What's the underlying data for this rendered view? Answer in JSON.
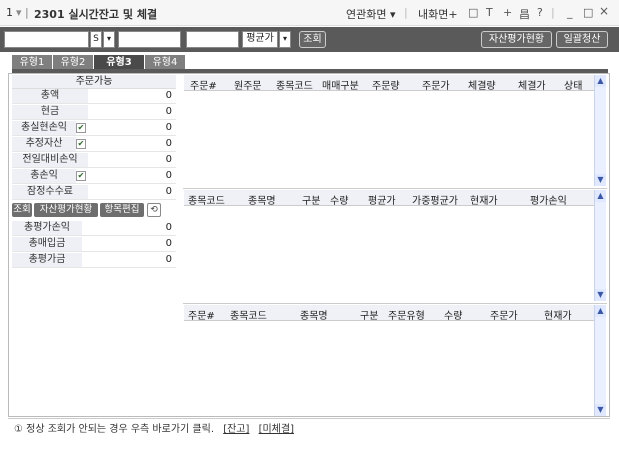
{
  "window": {
    "screen_no": "1",
    "title": "2301 실시간잔고 및 체결",
    "linked_screen": "연관화면",
    "my_screen": "내화면+",
    "icons": [
      "□",
      "T",
      "+",
      "昌",
      "?",
      "_",
      "□",
      "×"
    ]
  },
  "toolbar": {
    "account_suffix": "S",
    "avg_price_label": "평균가",
    "query_button": "조회",
    "asset_eval_button": "자산평가현황",
    "bulk_liquidate_button": "일괄청산"
  },
  "tabs": [
    "유형1",
    "유형2",
    "유형3",
    "유형4"
  ],
  "active_tab": 2,
  "left_panel": {
    "header": "주문가능",
    "rows": [
      {
        "label": "총액",
        "value": "0"
      },
      {
        "label": "현금",
        "value": "0"
      },
      {
        "label": "총실현손익",
        "value": "0"
      },
      {
        "label": "추정자산",
        "value": "0"
      },
      {
        "label": "전일대비손익",
        "value": "0"
      },
      {
        "label": "총손익",
        "value": "0"
      },
      {
        "label": "잠정수수료",
        "value": "0"
      }
    ],
    "buttons": [
      "조회",
      "자산평가현황",
      "항목편집"
    ],
    "rows2": [
      {
        "label": "총평가손익",
        "value": "0"
      },
      {
        "label": "총매입금",
        "value": "0"
      },
      {
        "label": "총평가금",
        "value": "0"
      }
    ]
  },
  "grid1": {
    "columns": [
      "주문#",
      "원주문",
      "종목코드",
      "매매구분",
      "주문량",
      "주문가",
      "체결량",
      "체결가",
      "상태"
    ]
  },
  "grid2": {
    "columns": [
      "종목코드",
      "종목명",
      "구분",
      "수량",
      "평균가",
      "가중평균가",
      "현재가",
      "평가손익"
    ]
  },
  "grid3": {
    "columns": [
      "주문#",
      "종목코드",
      "종목명",
      "구분",
      "주문유형",
      "수량",
      "주문가",
      "현재가"
    ]
  },
  "footer": {
    "notice": "① 정상 조회가 안되는 경우 우측 바로가기 클릭.",
    "link1": "[잔고]",
    "link2": "[미체결]"
  }
}
